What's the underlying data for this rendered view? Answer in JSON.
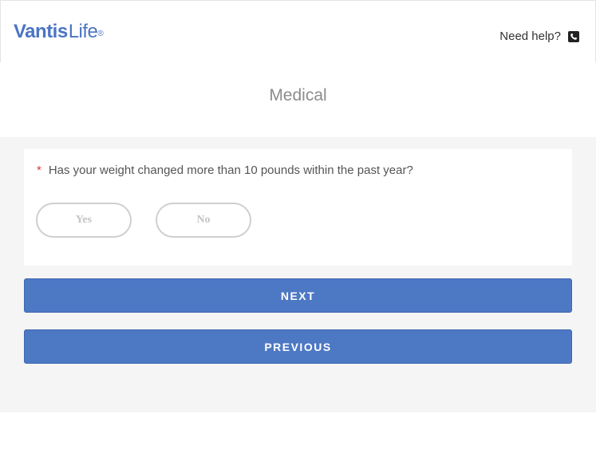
{
  "header": {
    "logo": {
      "word1": "Vantis",
      "word2": "Life",
      "reg": "®"
    },
    "help_label": "Need help?",
    "help_icon": "phone-icon"
  },
  "page": {
    "title": "Medical"
  },
  "question": {
    "required_marker": "*",
    "text": "Has your weight changed more than 10 pounds within the past year?",
    "options": [
      {
        "label": "Yes"
      },
      {
        "label": "No"
      }
    ]
  },
  "actions": {
    "next_label": "NEXT",
    "previous_label": "PREVIOUS"
  },
  "colors": {
    "brand": "#4a74c4",
    "button": "#4d78c4",
    "required": "#e0363b",
    "panel_bg": "#f5f5f5"
  }
}
